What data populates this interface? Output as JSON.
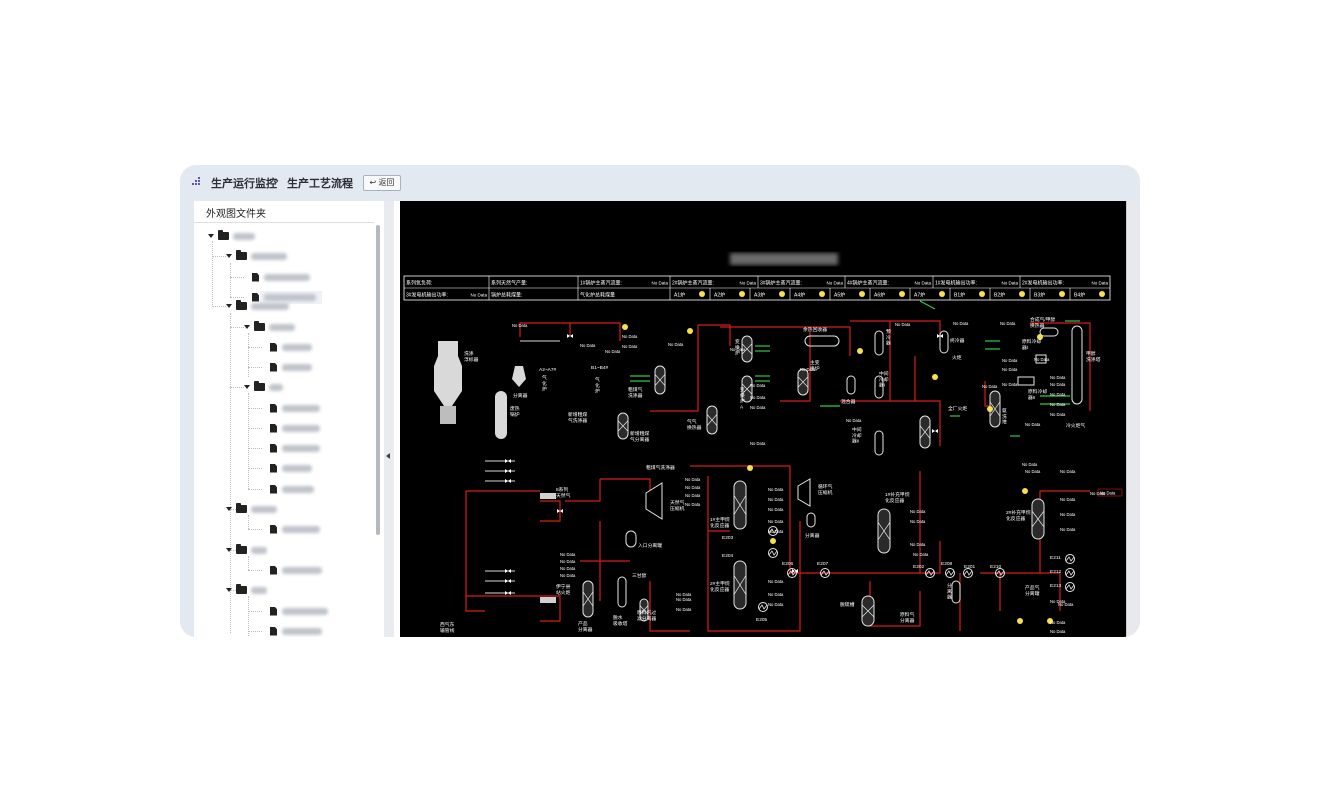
{
  "breadcrumb": {
    "root": "生产运行监控",
    "separator": "›",
    "current": "生产工艺流程"
  },
  "back_button": {
    "icon": "back-arrow-icon",
    "label": "返回"
  },
  "sidebar": {
    "title": "外观图文件夹"
  },
  "diagram": {
    "title_blurred": true,
    "status_table": {
      "row1": [
        {
          "label": "系列氧负荷:",
          "value": ""
        },
        {
          "label": "系列天然气产量:",
          "value": ""
        },
        {
          "label": "1#锅炉主蒸汽流量:",
          "value": "No Data"
        },
        {
          "label": "2#锅炉主蒸汽流量:",
          "value": "No Data"
        },
        {
          "label": "3#锅炉主蒸汽流量:",
          "value": "No Data"
        },
        {
          "label": "4#锅炉主蒸汽流量:",
          "value": "No Data"
        },
        {
          "label": "1#发电机输出功率:",
          "value": "No Data"
        },
        {
          "label": "2#发电机输出功率:",
          "value": "No Data"
        }
      ],
      "row2_left": [
        {
          "label": "3#发电机输出功率:",
          "value": "No Data"
        },
        {
          "label": "锅炉总耗煤量:",
          "value": ""
        },
        {
          "label": "气化炉总耗煤量",
          "value": ""
        }
      ],
      "row2_indicators": [
        "A1炉",
        "A2炉",
        "A3炉",
        "A4炉",
        "A5炉",
        "A6炉",
        "A7炉",
        "B1炉",
        "B2炉",
        "B3炉",
        "B4炉"
      ]
    },
    "no_data": "No Data",
    "labels": {
      "wash_tower": "洗涤\n浮标器",
      "separator": "分离器",
      "waste_boiler": "废热\n锅炉",
      "a2_a7": "A2~A7#",
      "gasifier": "气\n化\n炉",
      "b1_b4": "B1~B4#",
      "gasifier_b": "气\n化\n炉",
      "crude_gas_wash": "粗煤气\n洗涤器",
      "new_crude_wash": "新增粗煤\n气洗涤器",
      "new_crude_sep": "新增粗煤\n气分离器",
      "gas_exchanger": "气气\n换热器",
      "trans_boiler": "变\n换\n炉",
      "trans_boiler_a": "变\n换\n炉\nA",
      "waste_heat_rec": "余热回收器",
      "main_trans_boiler": "主变\n换炉",
      "mixer": "混合器",
      "pre_cooler": "预\n冷\n器",
      "mid_cooler_i": "中间\n冷却\n器I",
      "mid_cooler_ii": "中间\n冷却\n器II",
      "final_cooler": "终冷器",
      "torch": "火炬",
      "plant_torch": "全厂火炬",
      "ammonia_wash": "氨\n洗\n塔",
      "synthesis_exchanger": "合成气/甲醇\n换热器",
      "feed_cooler_i": "原料冷却\n器I",
      "feed_cooler_ii": "原料冷却\n器II",
      "methanol_wash": "甲醇\n洗涤塔",
      "cold_torch": "冷火炬气",
      "line_8": "8系列\n天然气",
      "dust_scrubber": "粗煤气洗涤器",
      "natural_gas_comp": "天然气\n压缩机",
      "separator_tank": "入口分离罐",
      "recycle_comp": "循环气\n压缩机",
      "syn_reactor_1": "1#主甲烷\n化反应器",
      "syn_reactor_2": "2#主甲烷\n化反应器",
      "sup_reactor_1": "1#补充甲烷\n化反应器",
      "sup_reactor_2": "2#补充甲烷\n化反应器",
      "separator_2": "分离器",
      "sep": "分\n离\n器",
      "prod_sep": "产品气\n分离罐",
      "yining_torch": "伊宁县\n站火炬",
      "west_east": "西气东\n输管线",
      "triethylene": "三甘醇",
      "product_sep": "产品\n分离器",
      "dehydrate": "脱水\n吸收塔",
      "feed_gas_sep": "原料气过\n滤分离器",
      "feed_sep": "原料气\n分离器",
      "deoxy": "脱硫槽",
      "e201": "E201",
      "e202": "E202",
      "e203": "E203",
      "e204": "E204",
      "e205": "E205",
      "e206": "E206",
      "e207": "E207",
      "e208": "E208",
      "e210": "E210",
      "e211": "E211",
      "e212": "E212",
      "e213": "E213"
    }
  },
  "colors": {
    "pipe_red": "#d81b1b",
    "pipe_green": "#31c94a",
    "indicator_yellow": "#f6e14a",
    "equipment": "#e6e6e6"
  }
}
